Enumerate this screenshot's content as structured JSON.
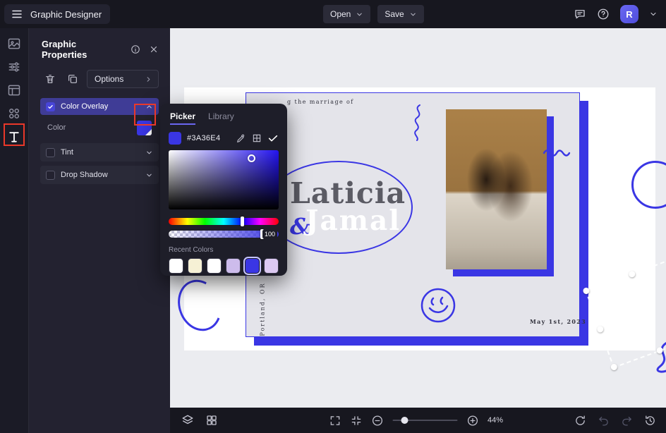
{
  "colors": {
    "accent": "#3A36E4",
    "panel_bg": "#232230",
    "topbar_bg": "#17171F",
    "canvas_bg": "#EBECF0",
    "annotation_red": "#EA3829",
    "selected_section_bg": "#3F3C96"
  },
  "topbar": {
    "title": "Graphic Designer",
    "open_label": "Open",
    "save_label": "Save",
    "avatar_initial": "R"
  },
  "properties_panel": {
    "title": "Graphic Properties",
    "options_label": "Options",
    "color_overlay": {
      "label": "Color Overlay",
      "checked": true
    },
    "color_row_label": "Color",
    "tint": {
      "label": "Tint",
      "checked": false
    },
    "drop_shadow": {
      "label": "Drop Shadow",
      "checked": false
    }
  },
  "color_picker": {
    "tab_picker": "Picker",
    "tab_library": "Library",
    "hex_value": "#3A36E4",
    "opacity_value": "100",
    "recent_colors_label": "Recent Colors",
    "recent_colors": [
      "#ffffff",
      "#f6f1d5",
      "#ffffff",
      "#cdbcec",
      "#3a36e4",
      "#dcc9f2"
    ]
  },
  "canvas_design": {
    "top_caption": "g the marriage of",
    "name_first": "Laticia",
    "ampersand": "&",
    "name_second": "Jamal",
    "location_text": "Portland, OR",
    "date_text": "May 1st, 2023"
  },
  "bottom_toolbar": {
    "zoom_level": "44%"
  }
}
